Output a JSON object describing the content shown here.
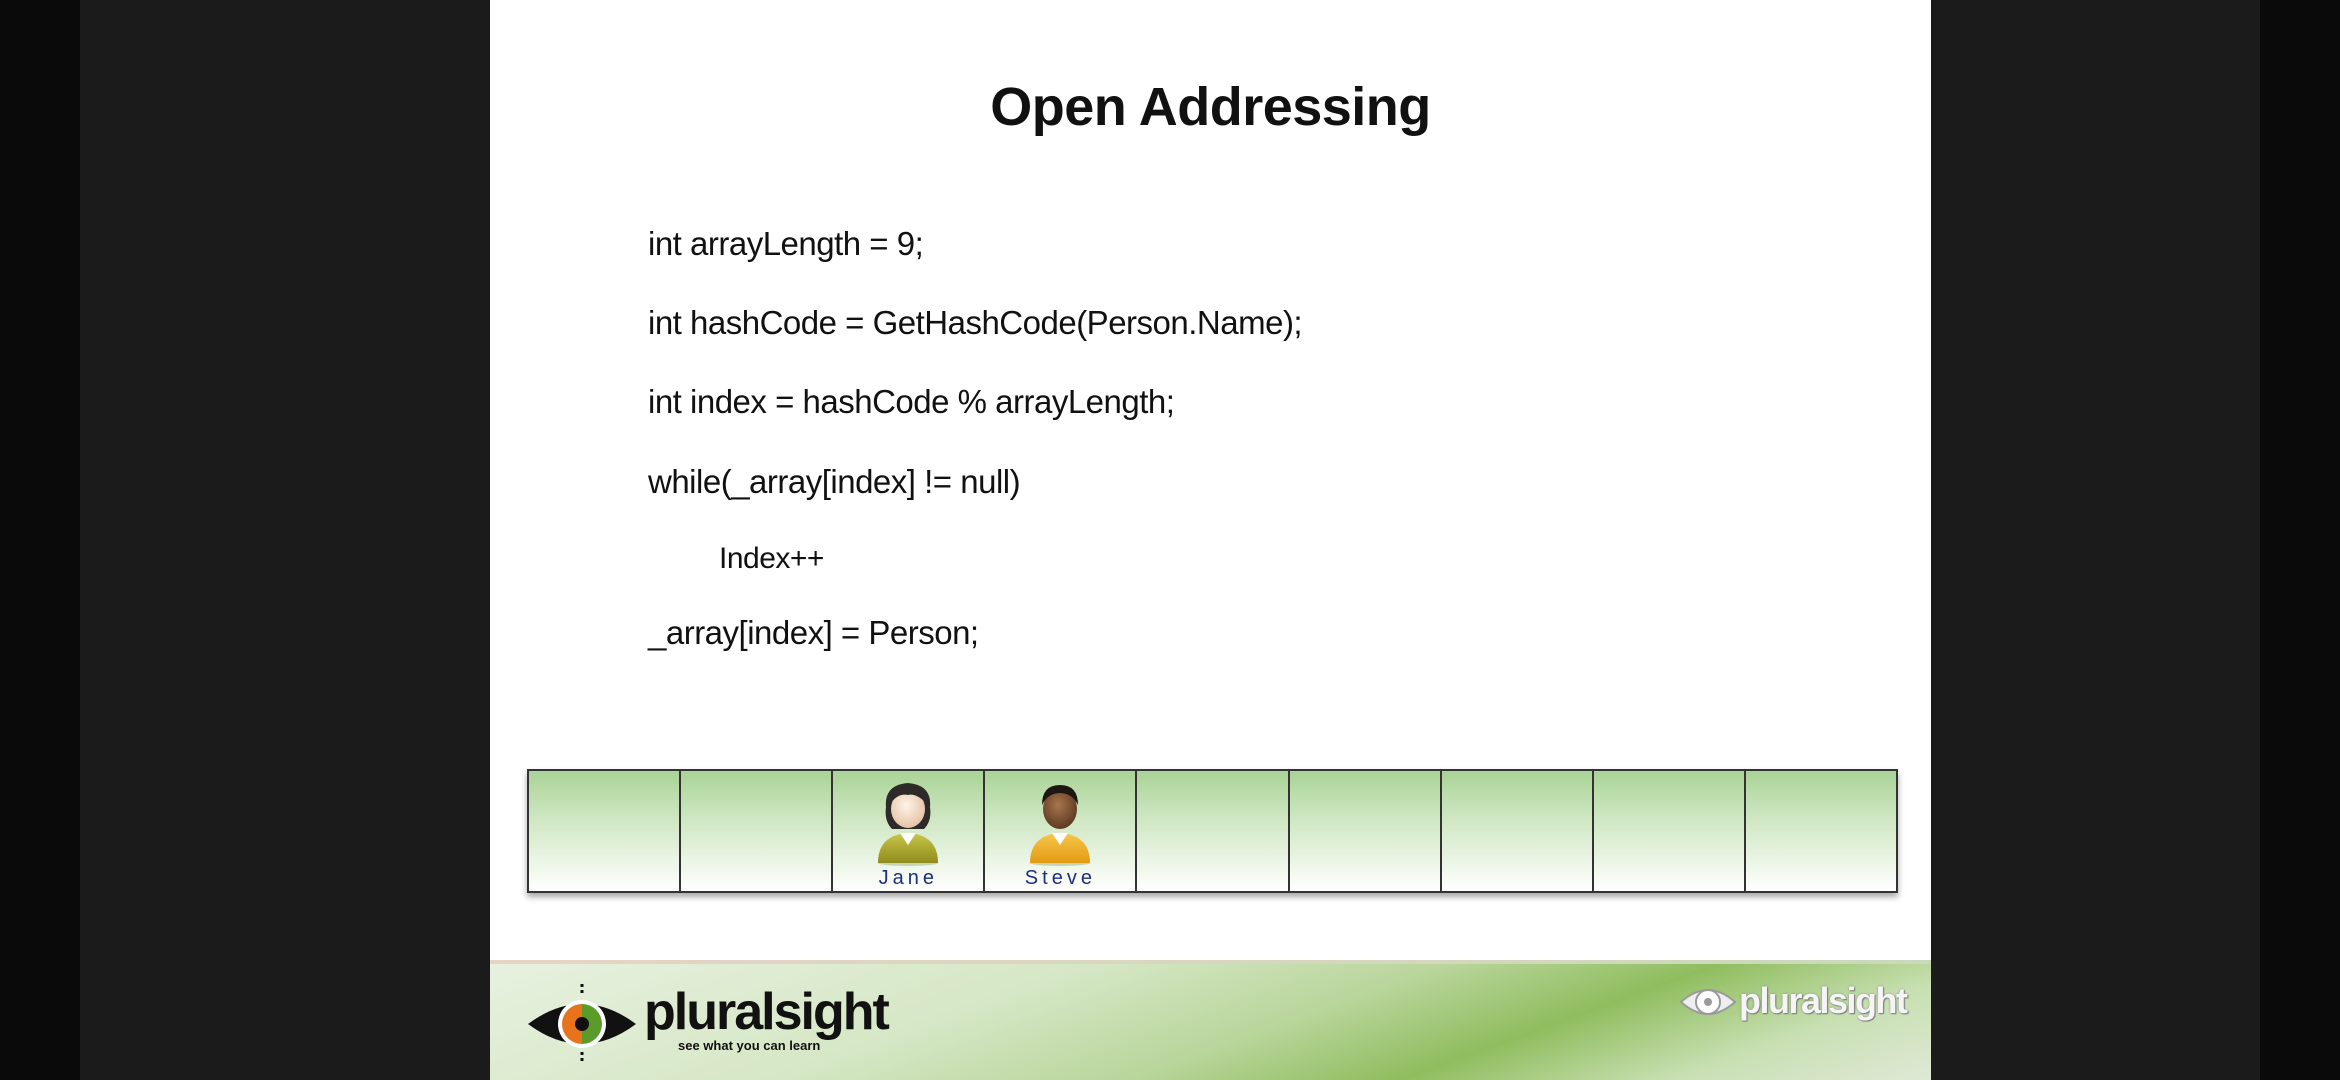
{
  "slide": {
    "title": "Open Addressing",
    "code_lines": [
      "int arrayLength = 9;",
      "int hashCode = GetHashCode(Person.Name);",
      "int index = hashCode % arrayLength;",
      "while(_array[index] != null)",
      "Index++",
      "_array[index] = Person;"
    ]
  },
  "array_cells": [
    {
      "person": null
    },
    {
      "person": null
    },
    {
      "person": "Jane"
    },
    {
      "person": "Steve"
    },
    {
      "person": null
    },
    {
      "person": null
    },
    {
      "person": null
    },
    {
      "person": null
    },
    {
      "person": null
    }
  ],
  "footer": {
    "logo_text": "pluralsight",
    "logo_tagline": "see what you can learn",
    "watermark_text": "pluralsight"
  },
  "colors": {
    "cell_green": "#a9d396",
    "name_blue": "#1c2f80",
    "logo_orange": "#e8731b",
    "logo_green": "#5a9b2a"
  }
}
